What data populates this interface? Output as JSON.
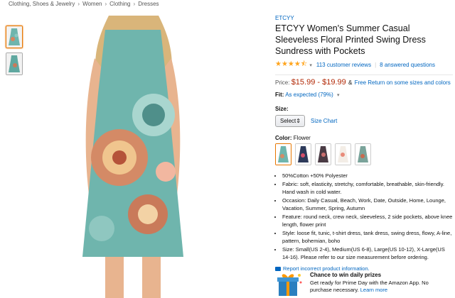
{
  "breadcrumb": [
    "Clothing, Shoes & Jewelry",
    "Women",
    "Clothing",
    "Dresses"
  ],
  "product": {
    "brand": "ETCYY",
    "title": "ETCYY Women's Summer Casual Sleeveless Floral Printed Swing Dress Sundress with Pockets",
    "rating": 4.5,
    "reviews_link": "113 customer reviews",
    "questions_link": "8 answered questions",
    "price_label": "Price:",
    "price": "$15.99 - $19.99",
    "amp": "&",
    "free_return": "Free Return on some sizes and colors",
    "fit_label": "Fit:",
    "fit_value": "As expected (79%)",
    "size_label": "Size:",
    "size_select": "Select",
    "size_chart": "Size Chart",
    "color_label": "Color:",
    "color_value": "Flower",
    "bullets": [
      "50%Cotton +50% Polyester",
      "Fabric: soft, elasticity, stretchy, comfortable, breathable, skin-friendly. Hand wash in cold water.",
      "Occasion: Daily Casual, Beach, Work, Date, Outside, Home, Lounge, Vacation, Summer, Spring, Autumn",
      "Feature: round neck, crew neck, sleeveless, 2 side pockets, above knee length, flower print",
      "Style: loose fit, tunic, t-shirt dress, tank dress, swing dress, flowy, A-line, pattern, bohemian, boho",
      "Size: Small(US 2-4), Medium(US 6-8), Large(US 10-12), X-Large(US 14-16). Please refer to our size measurement before ordering."
    ],
    "report_link": "Report incorrect product information."
  },
  "promo": {
    "title": "Chance to win daily prizes",
    "line1": "Get ready for Prime Day with the Amazon App. No",
    "line2": "purchase necessary.",
    "learn_more": "Learn more"
  },
  "colors": {
    "link": "#0066c0",
    "price": "#b12704",
    "star": "#ffa41c",
    "selected_border": "#e77600",
    "dress_base": "#6fb5ad"
  }
}
